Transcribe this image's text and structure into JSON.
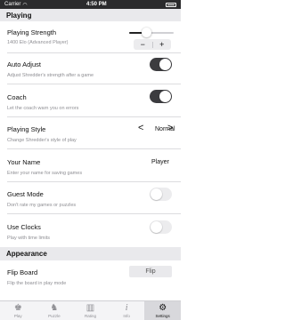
{
  "status_bar": {
    "carrier": "Carrier",
    "time": "4:50 PM"
  },
  "sections": {
    "playing": "Playing",
    "appearance": "Appearance"
  },
  "settings": {
    "playing_strength": {
      "title": "Playing Strength",
      "subtitle": "1400 Elo (Advanced Player)",
      "minus": "−",
      "plus": "+",
      "slider_fraction": 0.38
    },
    "auto_adjust": {
      "title": "Auto Adjust",
      "subtitle": "Adjust Shredder's strength after a game",
      "on": true
    },
    "coach": {
      "title": "Coach",
      "subtitle": "Let the coach warn you on errors",
      "on": true
    },
    "playing_style": {
      "title": "Playing Style",
      "subtitle": "Change Shredder's style of play",
      "value": "Normal",
      "prev": "<",
      "next": ">"
    },
    "your_name": {
      "title": "Your Name",
      "subtitle": "Enter your name for saving games",
      "value": "Player"
    },
    "guest_mode": {
      "title": "Guest Mode",
      "subtitle": "Don't rate my games or puzzles",
      "on": false
    },
    "use_clocks": {
      "title": "Use Clocks",
      "subtitle": "Play with time limits",
      "on": false
    },
    "flip_board": {
      "title": "Flip Board",
      "subtitle": "Flip the board in play mode",
      "button": "Flip"
    }
  },
  "tabs": [
    {
      "label": "Play",
      "icon": "play-icon",
      "glyph": "♚"
    },
    {
      "label": "Puzzle",
      "icon": "puzzle-icon",
      "glyph": "♞"
    },
    {
      "label": "Rating",
      "icon": "rating-icon",
      "glyph": "▥"
    },
    {
      "label": "Info",
      "icon": "info-icon",
      "glyph": "i"
    },
    {
      "label": "Settings",
      "icon": "gear-icon",
      "glyph": "⚙",
      "active": true
    }
  ],
  "colors": {
    "toggle_on": "#3c3c3f",
    "toggle_off": "#ececee",
    "section_bg": "#e9e9ec",
    "slider_fill": "#222222",
    "slider_rest": "#d0d0d4"
  }
}
